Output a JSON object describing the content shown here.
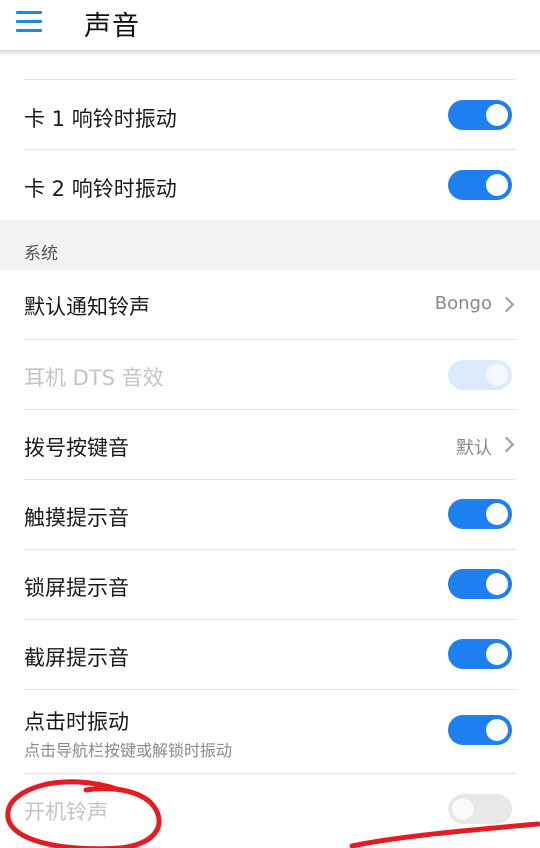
{
  "header": {
    "title": "声音",
    "menu_icon": "hamburger-menu-icon",
    "accent_color": "#1e88e5"
  },
  "rows_top": [
    {
      "label": "卡 1 响铃时振动",
      "toggle": "on"
    },
    {
      "label": "卡 2 响铃时振动",
      "toggle": "on"
    }
  ],
  "section": {
    "label": "系统"
  },
  "rows_system": [
    {
      "label": "默认通知铃声",
      "value": "Bongo",
      "type": "chevron"
    },
    {
      "label": "耳机 DTS 音效",
      "type": "toggle",
      "toggle": "on",
      "disabled": true
    },
    {
      "label": "拨号按键音",
      "value": "默认",
      "type": "chevron"
    },
    {
      "label": "触摸提示音",
      "type": "toggle",
      "toggle": "on"
    },
    {
      "label": "锁屏提示音",
      "type": "toggle",
      "toggle": "on"
    },
    {
      "label": "截屏提示音",
      "type": "toggle",
      "toggle": "on"
    },
    {
      "label": "点击时振动",
      "sublabel": "点击导航栏按键或解锁时振动",
      "type": "toggle",
      "toggle": "on"
    },
    {
      "label": "开机铃声",
      "type": "toggle",
      "toggle": "off",
      "disabled": true
    }
  ],
  "colors": {
    "toggle_on": "#1e7ff0",
    "section_bg": "#f2f2f2",
    "annotation_red": "#e31b23"
  }
}
